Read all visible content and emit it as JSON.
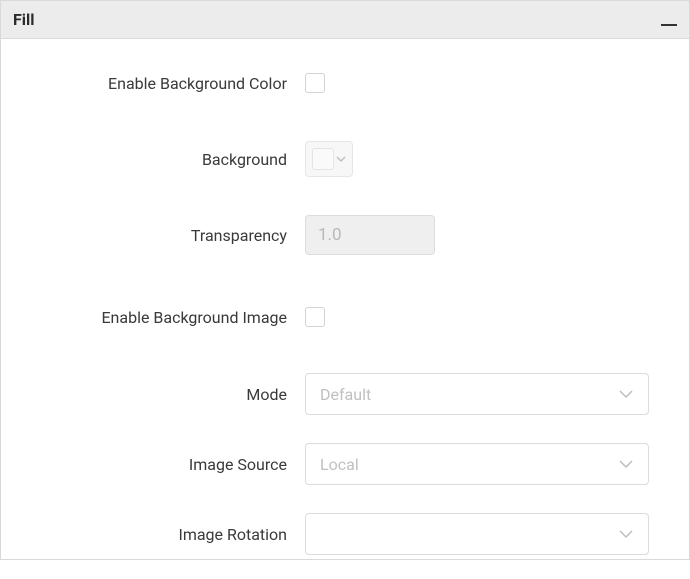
{
  "panel": {
    "title": "Fill"
  },
  "fields": {
    "enable_bg_color_label": "Enable Background Color",
    "background_label": "Background",
    "transparency_label": "Transparency",
    "transparency_value": "1.0",
    "enable_bg_image_label": "Enable Background Image",
    "mode_label": "Mode",
    "mode_value": "Default",
    "image_source_label": "Image Source",
    "image_source_value": "Local",
    "image_rotation_label": "Image Rotation",
    "image_rotation_value": ""
  }
}
